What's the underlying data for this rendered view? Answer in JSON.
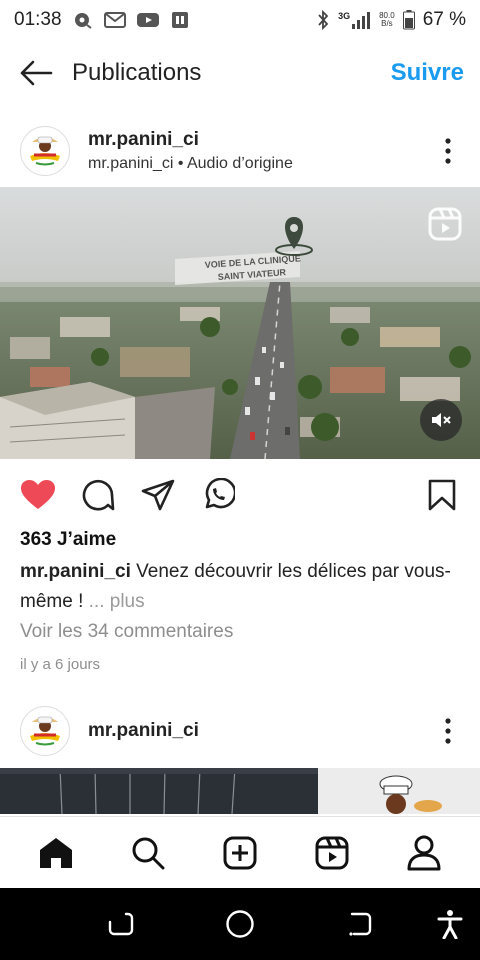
{
  "status_bar": {
    "time": "01:38",
    "network_type": "3G",
    "net_speed_value": "80.0",
    "net_speed_unit": "B/s",
    "battery_percent": "67 %"
  },
  "header": {
    "title": "Publications",
    "follow_label": "Suivre"
  },
  "post": {
    "username": "mr.panini_ci",
    "subline": "mr.panini_ci • Audio d’origine",
    "media_overlay_line1": "VOIE DE LA CLINIQUE",
    "media_overlay_line2": "SAINT VIATEUR",
    "likes": "363 J’aime",
    "caption_user": "mr.panini_ci",
    "caption_text": "Venez découvrir les délices par vous-même !",
    "caption_more": "... plus",
    "view_comments": "Voir les 34 commentaires",
    "time_ago": "il y a 6 jours",
    "liked": true
  },
  "post2": {
    "username": "mr.panini_ci"
  },
  "icons": {
    "heart": "heart-icon",
    "comment": "comment-icon",
    "share": "share-icon",
    "whatsapp": "whatsapp-icon",
    "save": "bookmark-icon",
    "home": "home-icon",
    "search": "search-icon",
    "create": "create-icon",
    "reels": "reels-icon",
    "profile": "profile-icon"
  },
  "colors": {
    "accent": "#1a9bf0",
    "like": "#ed4956"
  }
}
